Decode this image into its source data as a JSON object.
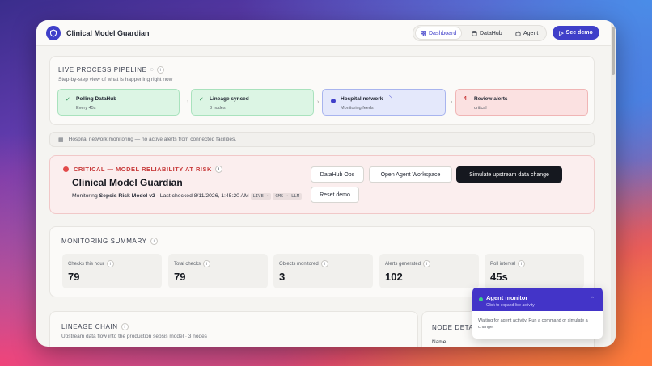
{
  "app": {
    "title": "Clinical Model Guardian"
  },
  "nav": {
    "dashboard": "Dashboard",
    "datahub": "DataHub",
    "agent": "Agent",
    "see_demo": "See demo"
  },
  "pipeline": {
    "title": "LIVE PROCESS PIPELINE",
    "subtitle": "Step-by-step view of what is happening right now",
    "steps": [
      {
        "label": "Polling DataHub",
        "sub": "Every 45s",
        "icon": "check-icon"
      },
      {
        "label": "Lineage synced",
        "sub": "3 nodes",
        "icon": "check-icon"
      },
      {
        "label": "Hospital network",
        "sub": "Monitoring feeds",
        "icon": "active-dot-icon"
      },
      {
        "label": "Review alerts",
        "sub": "critical",
        "count": "4"
      }
    ]
  },
  "notice": {
    "text": "Hospital network monitoring — no active alerts from connected facilities."
  },
  "alert": {
    "label": "CRITICAL — MODEL RELIABILITY AT RISK",
    "title": "Clinical Model Guardian",
    "monitoring_prefix": "Monitoring",
    "model": "Sepsis Risk Model v2",
    "last_checked": "· Last checked 8/11/2026, 1:45:20 AM",
    "tag1": "LIVE ·",
    "tag2": "GMS · LLM",
    "buttons": {
      "datahub_ops": "DataHub Ops",
      "open_workspace": "Open Agent Workspace",
      "simulate": "Simulate upstream data change",
      "reset": "Reset demo"
    }
  },
  "summary": {
    "title": "MONITORING SUMMARY",
    "stats": [
      {
        "label": "Checks this hour",
        "value": "79"
      },
      {
        "label": "Total checks",
        "value": "79"
      },
      {
        "label": "Objects monitored",
        "value": "3"
      },
      {
        "label": "Alerts generated",
        "value": "102"
      },
      {
        "label": "Poll interval",
        "value": "45s"
      }
    ]
  },
  "lineage": {
    "title": "LINEAGE CHAIN",
    "subtitle": "Upstream data flow into the production sepsis model · 3 nodes"
  },
  "node_details": {
    "title": "NODE DETAIL",
    "field": "Name"
  },
  "agent_monitor": {
    "title": "Agent monitor",
    "subtitle": "Click to expand live activity",
    "body": "Waiting for agent activity. Run a command or simulate a change."
  },
  "colors": {
    "accent": "#3f3fc9",
    "success_bg": "#dcf5e4",
    "active_bg": "#e4e8fb",
    "danger_bg": "#fbe1e1",
    "critical": "#c83b3b"
  }
}
